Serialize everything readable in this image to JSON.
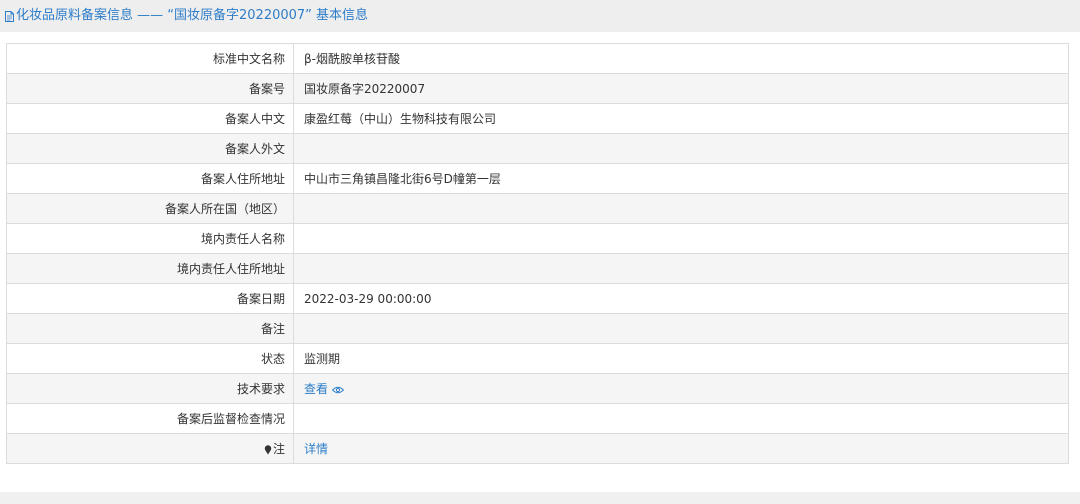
{
  "header": {
    "title": "化妆品原料备案信息 —— “国妆原备字20220007” 基本信息",
    "icon": "document-icon",
    "accent_color": "#2e7ec9"
  },
  "rows": [
    {
      "label": "标准中文名称",
      "value": "β-烟酰胺单核苷酸"
    },
    {
      "label": "备案号",
      "value": "国妆原备字20220007"
    },
    {
      "label": "备案人中文",
      "value": "康盈红莓（中山）生物科技有限公司"
    },
    {
      "label": "备案人外文",
      "value": ""
    },
    {
      "label": "备案人住所地址",
      "value": "中山市三角镇昌隆北街6号D幢第一层"
    },
    {
      "label": "备案人所在国（地区）",
      "value": ""
    },
    {
      "label": "境内责任人名称",
      "value": ""
    },
    {
      "label": "境内责任人住所地址",
      "value": ""
    },
    {
      "label": "备案日期",
      "value": "2022-03-29 00:00:00"
    },
    {
      "label": "备注",
      "value": ""
    },
    {
      "label": "状态",
      "value": "监测期"
    },
    {
      "label": "技术要求",
      "link": "查看",
      "icon": "eye-icon"
    },
    {
      "label": "备案后监督检查情况",
      "value": ""
    },
    {
      "label": "注",
      "label_icon": "pin-icon",
      "link": "详情"
    }
  ]
}
